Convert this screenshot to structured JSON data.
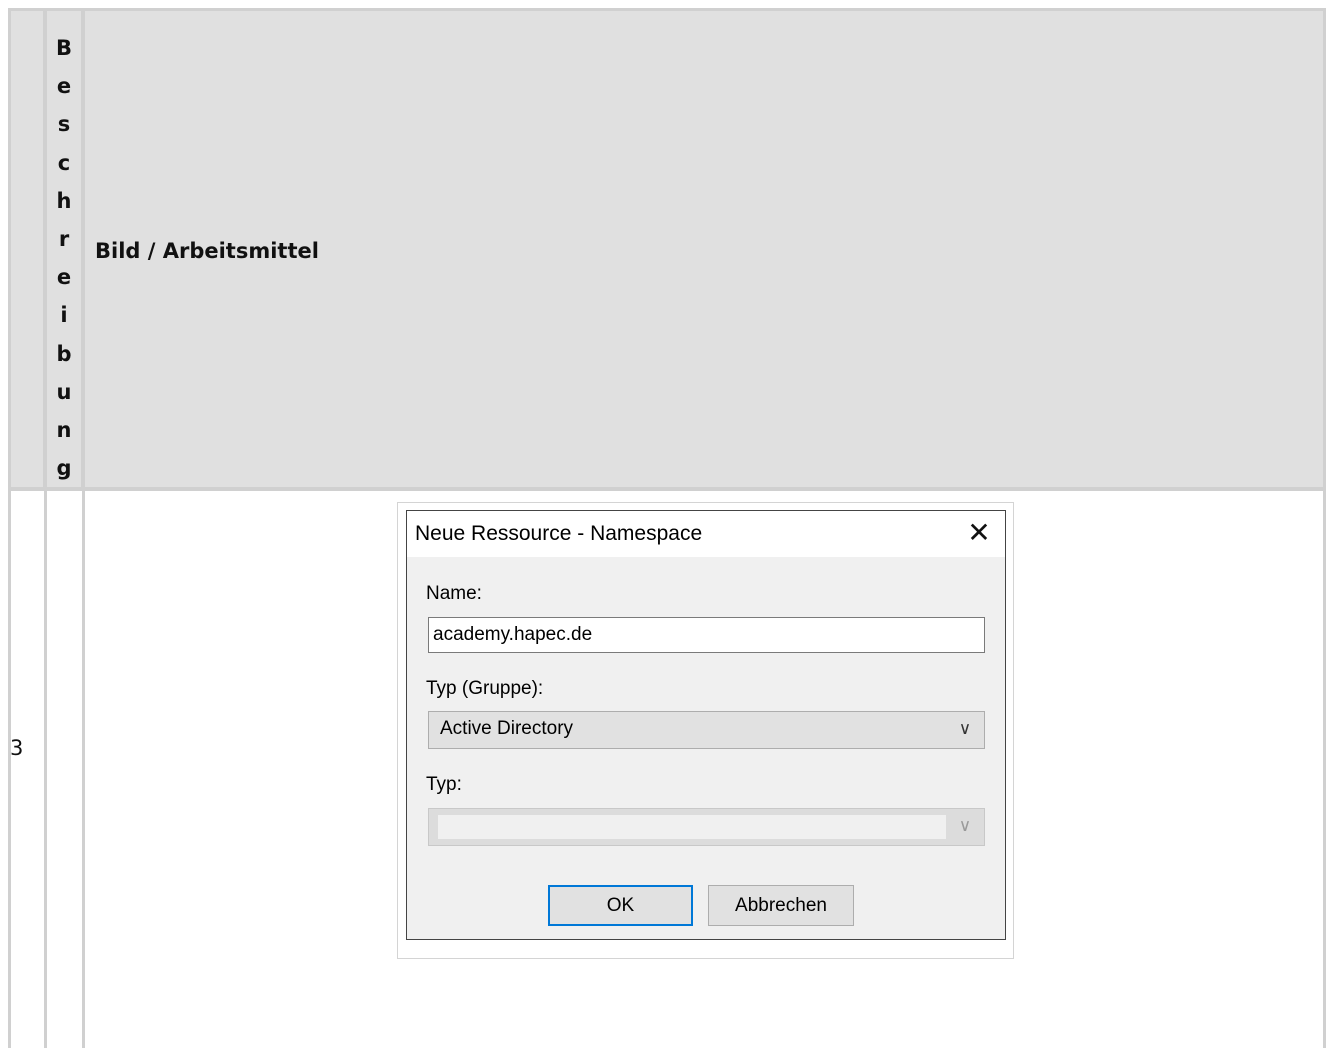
{
  "table": {
    "header": {
      "col2_letters": [
        "B",
        "e",
        "s",
        "c",
        "h",
        "r",
        "e",
        "i",
        "b",
        "u",
        "n",
        "g"
      ],
      "col3_title": "Bild / Arbeitsmittel"
    },
    "rows": [
      {
        "number": "3"
      }
    ]
  },
  "dialog": {
    "title": "Neue Ressource - Namespace",
    "close_icon": "close-icon",
    "name_label": "Name:",
    "name_value": "academy.hapec.de",
    "type_group_label": "Typ (Gruppe):",
    "type_group_value": "Active Directory",
    "type_label": "Typ:",
    "type_value": "",
    "ok_label": "OK",
    "cancel_label": "Abbrechen",
    "chevron_icon": "chevron-down-icon",
    "colors": {
      "accent": "#0078d7",
      "header_bg": "#e0e0e0",
      "border": "#d0d0d0"
    }
  }
}
